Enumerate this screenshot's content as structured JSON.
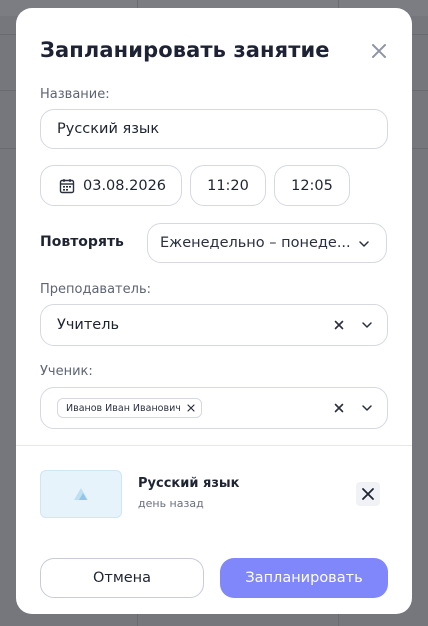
{
  "modal": {
    "title": "Запланировать занятие",
    "name_label": "Название:",
    "name_value": "Русский язык",
    "date_value": "03.08.2026",
    "time_start": "11:20",
    "time_end": "12:05",
    "repeat_label": "Повторять",
    "repeat_value": "Еженедельно – понеде...",
    "teacher_label": "Преподаватель:",
    "teacher_value": "Учитель",
    "student_label": "Ученик:",
    "student_chip": "Иванов Иван Иванович",
    "attachment": {
      "name": "Русский язык",
      "time": "день назад"
    },
    "cancel_label": "Отмена",
    "submit_label": "Запланировать"
  },
  "colors": {
    "accent": "#7f87fb",
    "overlay": "#6d6f76",
    "title": "#1d2235",
    "border": "#d6d9e1",
    "thumb_bg": "#e6f3fb"
  },
  "icons": [
    "close-icon",
    "calendar-icon",
    "chevron-down-icon",
    "clear-icon",
    "image-icon"
  ]
}
